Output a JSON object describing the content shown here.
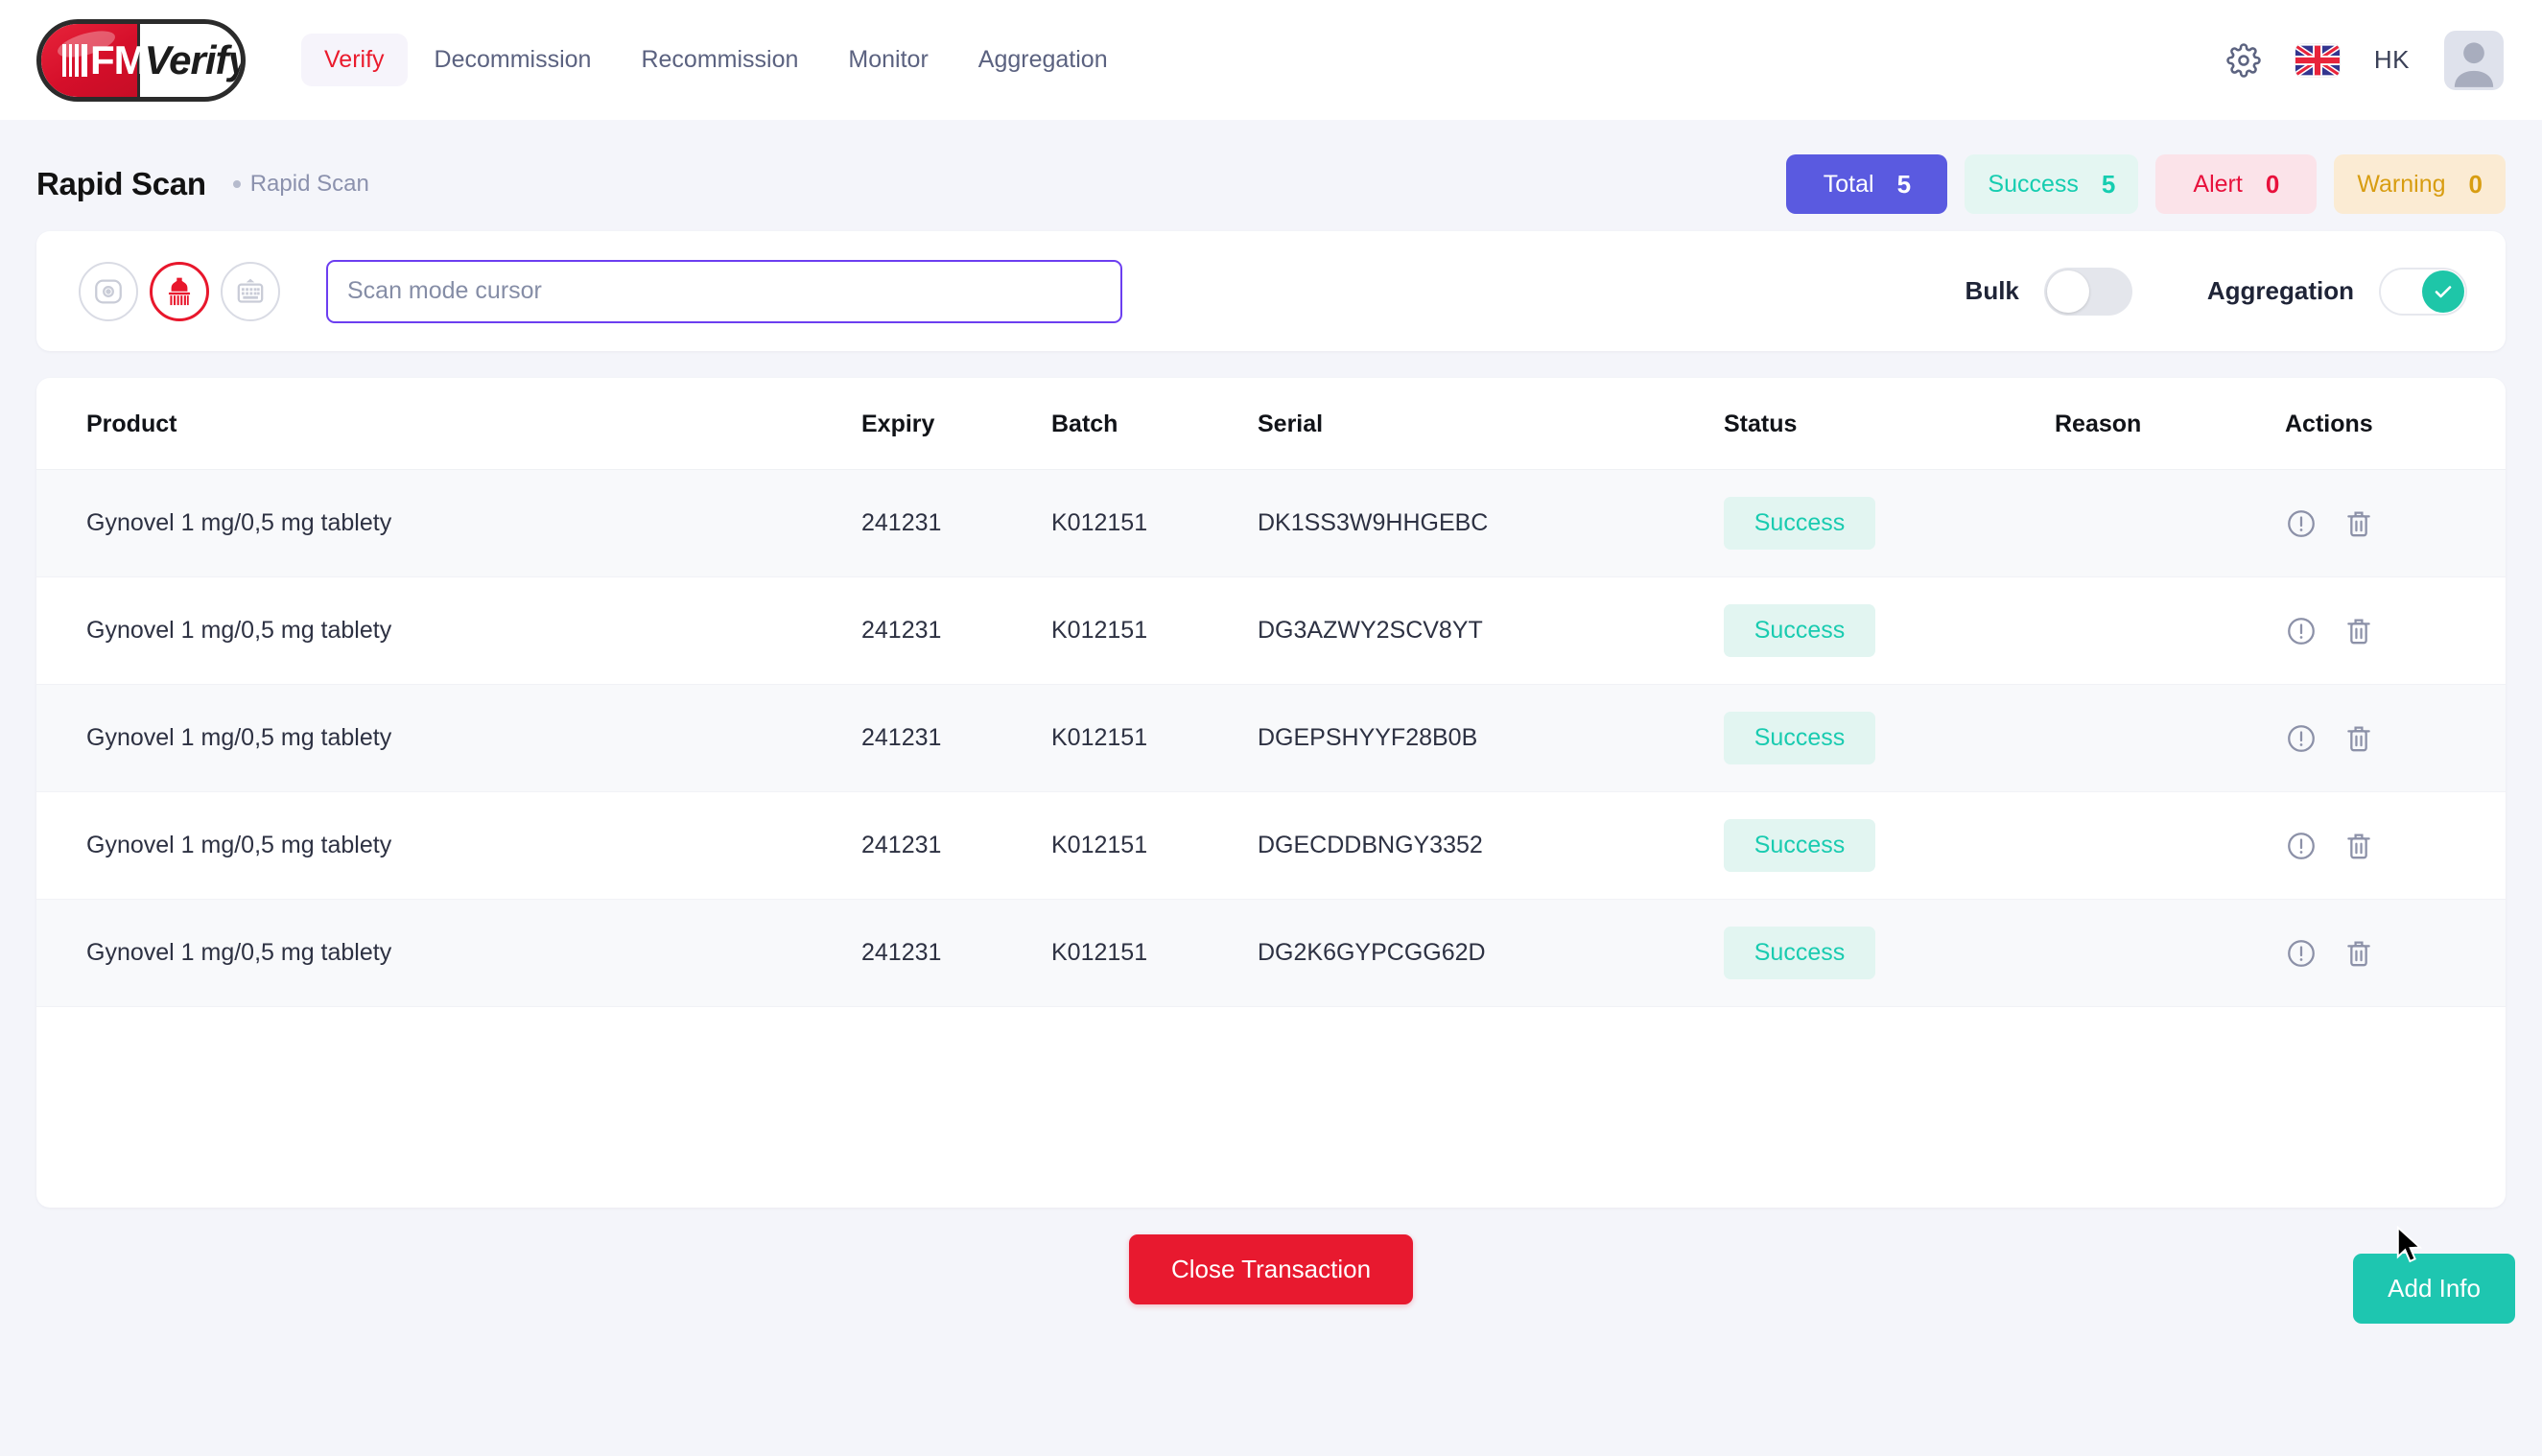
{
  "header": {
    "logo": {
      "bars_icon": "barcode-icon",
      "brand_fm": "FM",
      "brand_verify": "Verify"
    },
    "nav": [
      {
        "label": "Verify",
        "active": true
      },
      {
        "label": "Decommission",
        "active": false
      },
      {
        "label": "Recommission",
        "active": false
      },
      {
        "label": "Monitor",
        "active": false
      },
      {
        "label": "Aggregation",
        "active": false
      }
    ],
    "settings_icon": "gear-icon",
    "language_flag": "uk-flag-icon",
    "user_initials": "HK",
    "avatar_icon": "user-avatar-icon"
  },
  "page": {
    "title": "Rapid Scan",
    "breadcrumb": "Rapid Scan"
  },
  "stats": [
    {
      "label": "Total",
      "value": "5",
      "variant": "total",
      "color": "#5a5ae0"
    },
    {
      "label": "Success",
      "value": "5",
      "variant": "success",
      "color": "#15cdb0"
    },
    {
      "label": "Alert",
      "value": "0",
      "variant": "alert",
      "color": "#e8113c"
    },
    {
      "label": "Warning",
      "value": "0",
      "variant": "warning",
      "color": "#d89d11"
    }
  ],
  "scan": {
    "modes": [
      {
        "icon": "camera-scan-icon",
        "active": false
      },
      {
        "icon": "barcode-scanner-gun-icon",
        "active": true
      },
      {
        "icon": "keyboard-icon",
        "active": false
      }
    ],
    "input_value": "",
    "input_placeholder": "Scan mode cursor",
    "bulk_label": "Bulk",
    "bulk_on": false,
    "aggregation_label": "Aggregation",
    "aggregation_on": true,
    "toggle_on_color": "#1ec6a8",
    "input_focus_color": "#6c3ef0"
  },
  "table": {
    "columns": [
      "Product",
      "Expiry",
      "Batch",
      "Serial",
      "Status",
      "Reason",
      "Actions"
    ],
    "rows": [
      {
        "product": "Gynovel 1 mg/0,5 mg tablety",
        "expiry": "241231",
        "batch": "K012151",
        "serial": "DK1SS3W9HHGEBC",
        "status": "Success",
        "reason": ""
      },
      {
        "product": "Gynovel 1 mg/0,5 mg tablety",
        "expiry": "241231",
        "batch": "K012151",
        "serial": "DG3AZWY2SCV8YT",
        "status": "Success",
        "reason": ""
      },
      {
        "product": "Gynovel 1 mg/0,5 mg tablety",
        "expiry": "241231",
        "batch": "K012151",
        "serial": "DGEPSHYYF28B0B",
        "status": "Success",
        "reason": ""
      },
      {
        "product": "Gynovel 1 mg/0,5 mg tablety",
        "expiry": "241231",
        "batch": "K012151",
        "serial": "DGECDDBNGY3352",
        "status": "Success",
        "reason": ""
      },
      {
        "product": "Gynovel 1 mg/0,5 mg tablety",
        "expiry": "241231",
        "batch": "K012151",
        "serial": "DG2K6GYPCGG62D",
        "status": "Success",
        "reason": ""
      }
    ],
    "row_actions": [
      {
        "icon": "info-circle-icon"
      },
      {
        "icon": "trash-icon"
      }
    ]
  },
  "footer": {
    "close_label": "Close Transaction",
    "close_color": "#e8192f",
    "add_label": "Add Info",
    "add_color": "#1ec6b0"
  }
}
